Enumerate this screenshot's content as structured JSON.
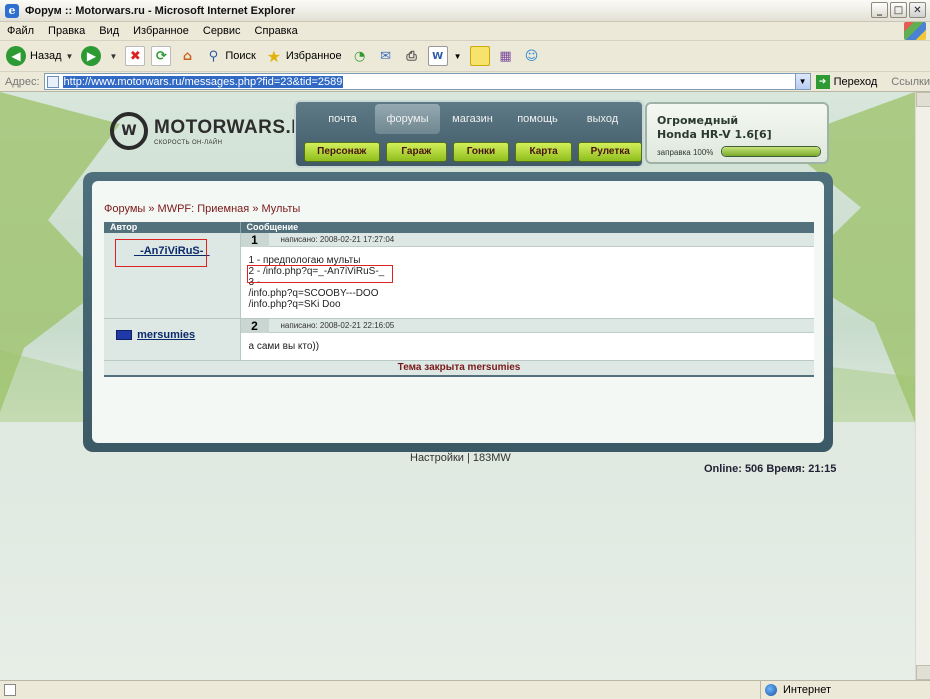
{
  "window": {
    "title": "Форум :: Motorwars.ru - Microsoft Internet Explorer"
  },
  "menu": [
    "Файл",
    "Правка",
    "Вид",
    "Избранное",
    "Сервис",
    "Справка"
  ],
  "toolbar": {
    "back": "Назад",
    "search": "Поиск",
    "favorites": "Избранное"
  },
  "address": {
    "label": "Адрес:",
    "url": "http://www.motorwars.ru/messages.php?fid=23&tid=2589",
    "go": "Переход",
    "links": "Ссылки"
  },
  "status": {
    "zone": "Интернет"
  },
  "site": {
    "logo_name": "MOTORWARS.RU",
    "logo_tagline": "СКОРОСТЬ ОН-ЛАЙН",
    "nav_tabs": [
      "почта",
      "форумы",
      "магазин",
      "помощь",
      "выход"
    ],
    "sub_buttons": [
      "Персонаж",
      "Гараж",
      "Гонки",
      "Карта",
      "Рулетка"
    ],
    "car": {
      "line1": "Огромедный",
      "line2": "Honda HR-V 1.6[6]",
      "fuel_label": "заправка 100%",
      "fuel_percent": 100
    }
  },
  "forum": {
    "breadcrumb": "Форумы » MWPF: Приемная » Мульты",
    "col_author": "Автор",
    "col_message": "Сообщение",
    "posts": [
      {
        "author": "_-An7iViRuS-_",
        "num": "1",
        "date": "написано: 2008-02-21 17:27:04",
        "lines": [
          "1 - предпологаю мульты",
          "2 - /info.php?q=_-An7iViRuS-_",
          "3 -",
          "/info.php?q=SCOOBY---DOO",
          "/info.php?q=SKi Doo"
        ]
      },
      {
        "author": "mersumies",
        "num": "2",
        "date": "написано: 2008-02-21 22:16:05",
        "lines": [
          "а сами вы кто))"
        ]
      }
    ],
    "closed": "Тема закрыта mersumies"
  },
  "footer": {
    "links": "Настройки | 183MW",
    "online": "Online: 506  Время: 21:15"
  }
}
